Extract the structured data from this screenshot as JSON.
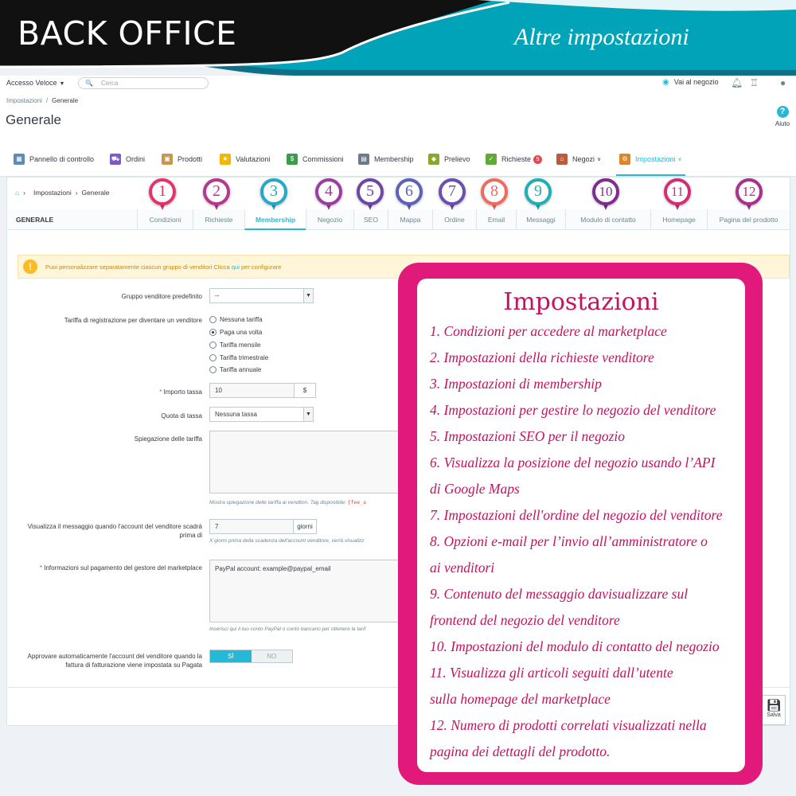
{
  "banner": {
    "title": "BACK OFFICE",
    "subtitle": "Altre impostazioni",
    "colors": {
      "primary": "#0d0d0d",
      "accent": "#00a3b8"
    }
  },
  "topbar": {
    "quick_access": "Accesso Veloce",
    "search_placeholder": "Cerca",
    "shop_link": "Vai al negozio",
    "icons": [
      "eye-icon",
      "bell-icon",
      "trophy-icon",
      "account-icon"
    ]
  },
  "header": {
    "breadcrumb": [
      "Impostazioni",
      "Generale"
    ],
    "title": "Generale",
    "help_label": "Aiuto"
  },
  "menu": [
    {
      "label": "Pannello di controllo",
      "icon": "dashboard-icon"
    },
    {
      "label": "Ordini",
      "icon": "cart-icon"
    },
    {
      "label": "Prodotti",
      "icon": "box-icon"
    },
    {
      "label": "Valutazioni",
      "icon": "star-icon"
    },
    {
      "label": "Commissioni",
      "icon": "money-icon"
    },
    {
      "label": "Membership",
      "icon": "card-icon"
    },
    {
      "label": "Prelievo",
      "icon": "bag-icon"
    },
    {
      "label": "Richieste",
      "icon": "check-icon",
      "badge": "5"
    },
    {
      "label": "Negozi",
      "icon": "store-icon"
    },
    {
      "label": "Impostazioni",
      "icon": "gears-icon",
      "active": true
    }
  ],
  "panel": {
    "breadcrumb": [
      "Impostazioni",
      "Generale"
    ],
    "section_title": "GENERALE",
    "tabs": [
      {
        "label": "Condizioni",
        "num": "1",
        "color": "#e2336b"
      },
      {
        "label": "Richieste",
        "num": "2",
        "color": "#b5378f"
      },
      {
        "label": "Membership",
        "num": "3",
        "color": "#24a9c9",
        "active": true
      },
      {
        "label": "Negozio",
        "num": "4",
        "color": "#9b3ea2"
      },
      {
        "label": "SEO",
        "num": "5",
        "color": "#6b47a8"
      },
      {
        "label": "Mappa",
        "num": "6",
        "color": "#5b62b8"
      },
      {
        "label": "Ordine",
        "num": "7",
        "color": "#6a4fb1"
      },
      {
        "label": "Email",
        "num": "8",
        "color": "#f06b5f"
      },
      {
        "label": "Messaggi",
        "num": "9",
        "color": "#1fb0b4"
      },
      {
        "label": "Modulo di contatto",
        "num": "10",
        "color": "#7e2c8f"
      },
      {
        "label": "Homepage",
        "num": "11",
        "color": "#d42d75"
      },
      {
        "label": "Pagina del prodotto",
        "num": "12",
        "color": "#a8308f"
      }
    ],
    "alert": {
      "text": "Puoi personalizzare separatamente ciascun gruppo di venditori Clicca ",
      "link": "qui",
      "text_after": " per configurare"
    },
    "fields": {
      "group_label": "Gruppo venditore predefinito",
      "group_value": "--",
      "fee_label": "Tariffa di registrazione per diventare un venditore",
      "fee_options": [
        "Nessuna tariffa",
        "Paga una volta",
        "Tariffa mensile",
        "Tariffa trimestrale",
        "Tariffa annuale"
      ],
      "fee_selected_index": 1,
      "amount_label": "Importo tassa",
      "amount_value": "10",
      "amount_unit": "$",
      "tax_label": "Quota di tassa",
      "tax_value": "Nessuna tassa",
      "explain_label": "Spiegazione delle tariffa",
      "explain_hint": "Mostra spiegazione delle tariffa ai venditori. Tag disponibile: ",
      "explain_hint_tag": "{fee_a",
      "message_label": "Visualizza il messaggio quando l'account del venditore scadrà prima di",
      "message_value": "7",
      "message_unit": "giorni",
      "message_hint": "X giorni prima della scadenza dell'account venditore, verrà visualizz",
      "payment_label": "Informazioni sul pagamento del gestore del marketplace",
      "payment_value": "PayPal account: example@paypal_email",
      "payment_hint": "Inserisci qui il tuo conto PayPal o conto bancario per ottenere la tarif",
      "approve_label": "Approvare automaticamente l'account del venditore quando la fattura di fatturazione viene impostata su Pagata",
      "toggle_yes": "SÌ",
      "toggle_no": "NO",
      "save_label": "Salva"
    }
  },
  "card": {
    "title": "Impostazioni",
    "lines": [
      "1. Condizioni per accedere al marketplace",
      "2. Impostazioni della richieste venditore",
      "3. Impostazioni di membership",
      "4. Impostazioni per gestire lo negozio del venditore",
      "5. Impostazioni SEO per il negozio",
      "6. Visualizza la posizione del negozio usando l’API",
      "di Google Maps",
      "7. Impostazioni dell'ordine del negozio del venditore",
      "8. Opzioni e-mail per l’invio all’amministratore o",
      "ai venditori",
      "9. Contenuto del messaggio davisualizzare sul",
      "frontend del negozio del venditore",
      "10. Impostazioni del modulo di contatto del negozio",
      "11. Visualizza gli articoli seguiti dall’utente",
      "sulla homepage del marketplace",
      "12. Numero di prodotti correlati visualizzati nella",
      "pagina dei dettagli del prodotto."
    ]
  }
}
